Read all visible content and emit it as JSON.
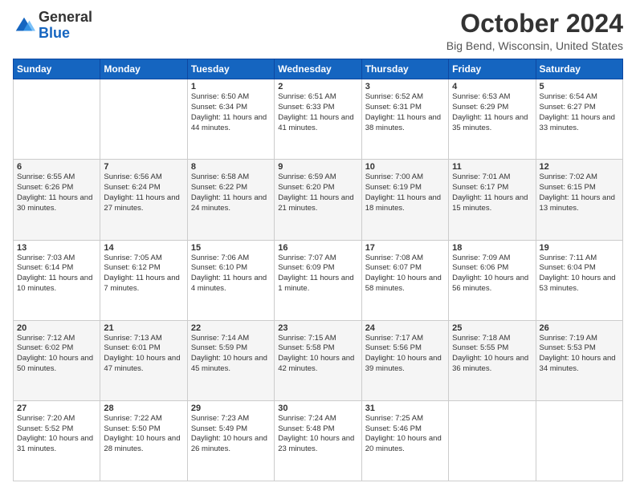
{
  "header": {
    "logo_general": "General",
    "logo_blue": "Blue",
    "month_title": "October 2024",
    "location": "Big Bend, Wisconsin, United States"
  },
  "days_of_week": [
    "Sunday",
    "Monday",
    "Tuesday",
    "Wednesday",
    "Thursday",
    "Friday",
    "Saturday"
  ],
  "weeks": [
    [
      {
        "day": "",
        "info": ""
      },
      {
        "day": "",
        "info": ""
      },
      {
        "day": "1",
        "info": "Sunrise: 6:50 AM\nSunset: 6:34 PM\nDaylight: 11 hours and 44 minutes."
      },
      {
        "day": "2",
        "info": "Sunrise: 6:51 AM\nSunset: 6:33 PM\nDaylight: 11 hours and 41 minutes."
      },
      {
        "day": "3",
        "info": "Sunrise: 6:52 AM\nSunset: 6:31 PM\nDaylight: 11 hours and 38 minutes."
      },
      {
        "day": "4",
        "info": "Sunrise: 6:53 AM\nSunset: 6:29 PM\nDaylight: 11 hours and 35 minutes."
      },
      {
        "day": "5",
        "info": "Sunrise: 6:54 AM\nSunset: 6:27 PM\nDaylight: 11 hours and 33 minutes."
      }
    ],
    [
      {
        "day": "6",
        "info": "Sunrise: 6:55 AM\nSunset: 6:26 PM\nDaylight: 11 hours and 30 minutes."
      },
      {
        "day": "7",
        "info": "Sunrise: 6:56 AM\nSunset: 6:24 PM\nDaylight: 11 hours and 27 minutes."
      },
      {
        "day": "8",
        "info": "Sunrise: 6:58 AM\nSunset: 6:22 PM\nDaylight: 11 hours and 24 minutes."
      },
      {
        "day": "9",
        "info": "Sunrise: 6:59 AM\nSunset: 6:20 PM\nDaylight: 11 hours and 21 minutes."
      },
      {
        "day": "10",
        "info": "Sunrise: 7:00 AM\nSunset: 6:19 PM\nDaylight: 11 hours and 18 minutes."
      },
      {
        "day": "11",
        "info": "Sunrise: 7:01 AM\nSunset: 6:17 PM\nDaylight: 11 hours and 15 minutes."
      },
      {
        "day": "12",
        "info": "Sunrise: 7:02 AM\nSunset: 6:15 PM\nDaylight: 11 hours and 13 minutes."
      }
    ],
    [
      {
        "day": "13",
        "info": "Sunrise: 7:03 AM\nSunset: 6:14 PM\nDaylight: 11 hours and 10 minutes."
      },
      {
        "day": "14",
        "info": "Sunrise: 7:05 AM\nSunset: 6:12 PM\nDaylight: 11 hours and 7 minutes."
      },
      {
        "day": "15",
        "info": "Sunrise: 7:06 AM\nSunset: 6:10 PM\nDaylight: 11 hours and 4 minutes."
      },
      {
        "day": "16",
        "info": "Sunrise: 7:07 AM\nSunset: 6:09 PM\nDaylight: 11 hours and 1 minute."
      },
      {
        "day": "17",
        "info": "Sunrise: 7:08 AM\nSunset: 6:07 PM\nDaylight: 10 hours and 58 minutes."
      },
      {
        "day": "18",
        "info": "Sunrise: 7:09 AM\nSunset: 6:06 PM\nDaylight: 10 hours and 56 minutes."
      },
      {
        "day": "19",
        "info": "Sunrise: 7:11 AM\nSunset: 6:04 PM\nDaylight: 10 hours and 53 minutes."
      }
    ],
    [
      {
        "day": "20",
        "info": "Sunrise: 7:12 AM\nSunset: 6:02 PM\nDaylight: 10 hours and 50 minutes."
      },
      {
        "day": "21",
        "info": "Sunrise: 7:13 AM\nSunset: 6:01 PM\nDaylight: 10 hours and 47 minutes."
      },
      {
        "day": "22",
        "info": "Sunrise: 7:14 AM\nSunset: 5:59 PM\nDaylight: 10 hours and 45 minutes."
      },
      {
        "day": "23",
        "info": "Sunrise: 7:15 AM\nSunset: 5:58 PM\nDaylight: 10 hours and 42 minutes."
      },
      {
        "day": "24",
        "info": "Sunrise: 7:17 AM\nSunset: 5:56 PM\nDaylight: 10 hours and 39 minutes."
      },
      {
        "day": "25",
        "info": "Sunrise: 7:18 AM\nSunset: 5:55 PM\nDaylight: 10 hours and 36 minutes."
      },
      {
        "day": "26",
        "info": "Sunrise: 7:19 AM\nSunset: 5:53 PM\nDaylight: 10 hours and 34 minutes."
      }
    ],
    [
      {
        "day": "27",
        "info": "Sunrise: 7:20 AM\nSunset: 5:52 PM\nDaylight: 10 hours and 31 minutes."
      },
      {
        "day": "28",
        "info": "Sunrise: 7:22 AM\nSunset: 5:50 PM\nDaylight: 10 hours and 28 minutes."
      },
      {
        "day": "29",
        "info": "Sunrise: 7:23 AM\nSunset: 5:49 PM\nDaylight: 10 hours and 26 minutes."
      },
      {
        "day": "30",
        "info": "Sunrise: 7:24 AM\nSunset: 5:48 PM\nDaylight: 10 hours and 23 minutes."
      },
      {
        "day": "31",
        "info": "Sunrise: 7:25 AM\nSunset: 5:46 PM\nDaylight: 10 hours and 20 minutes."
      },
      {
        "day": "",
        "info": ""
      },
      {
        "day": "",
        "info": ""
      }
    ]
  ]
}
